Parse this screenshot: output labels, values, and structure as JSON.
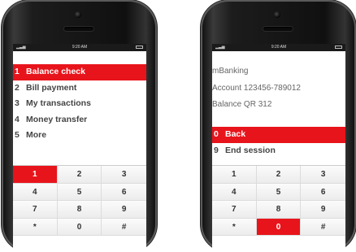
{
  "colors": {
    "accent": "#e8141b",
    "phone_body": "#1a1a1a",
    "screen_bg": "#ffffff"
  },
  "left_phone": {
    "status_time": "9:20 AM",
    "menu": [
      {
        "num": "1",
        "label": "Balance check",
        "selected": true
      },
      {
        "num": "2",
        "label": "Bill payment",
        "selected": false
      },
      {
        "num": "3",
        "label": "My transactions",
        "selected": false
      },
      {
        "num": "4",
        "label": "Money transfer",
        "selected": false
      },
      {
        "num": "5",
        "label": "More",
        "selected": false
      }
    ],
    "keypad": [
      "1",
      "2",
      "3",
      "4",
      "5",
      "6",
      "7",
      "8",
      "9",
      "*",
      "0",
      "#"
    ],
    "highlighted_key": "1"
  },
  "right_phone": {
    "status_time": "9:20 AM",
    "info_lines": [
      "mBanking",
      "Account 123456-789012",
      "Balance QR 312"
    ],
    "menu": [
      {
        "num": "0",
        "label": "Back",
        "selected": true
      },
      {
        "num": "9",
        "label": "End session",
        "selected": false
      }
    ],
    "keypad": [
      "1",
      "2",
      "3",
      "4",
      "5",
      "6",
      "7",
      "8",
      "9",
      "*",
      "0",
      "#"
    ],
    "highlighted_key": "0"
  }
}
